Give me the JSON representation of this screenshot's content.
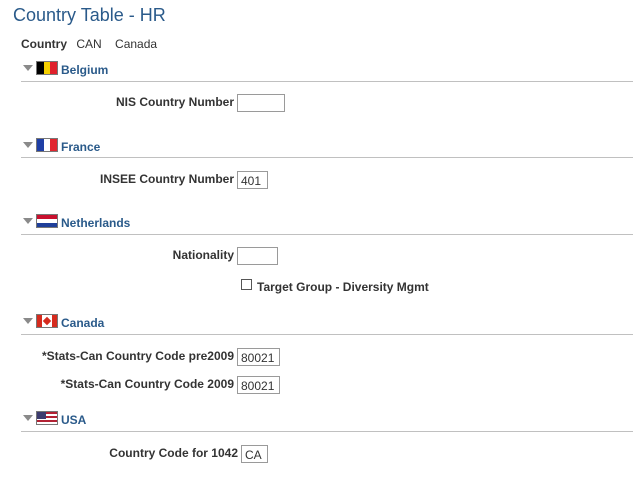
{
  "page": {
    "title": "Country Table - HR"
  },
  "country": {
    "label": "Country",
    "code": "CAN",
    "name": "Canada"
  },
  "colors": {
    "title": "#2a5a8a",
    "section_label": "#2a5a8a",
    "rule": "#c0c0c0",
    "input_border": "#9a9a9a"
  },
  "sections": {
    "belgium": {
      "label": "Belgium",
      "icon": "belgium-flag-icon",
      "fields": {
        "nis_country_number": {
          "label": "NIS Country Number",
          "value": ""
        }
      }
    },
    "france": {
      "label": "France",
      "icon": "france-flag-icon",
      "fields": {
        "insee_country_number": {
          "label": "INSEE Country Number",
          "value": "401"
        }
      }
    },
    "netherlands": {
      "label": "Netherlands",
      "icon": "netherlands-flag-icon",
      "fields": {
        "nationality": {
          "label": "Nationality",
          "value": ""
        },
        "target_group": {
          "label": "Target Group - Diversity Mgmt",
          "checked": false
        }
      }
    },
    "canada": {
      "label": "Canada",
      "icon": "canada-flag-icon",
      "fields": {
        "stats_can_pre2009": {
          "label": "*Stats-Can Country Code pre2009",
          "value": "80021"
        },
        "stats_can_2009": {
          "label": "*Stats-Can Country Code 2009",
          "value": "80021"
        }
      }
    },
    "usa": {
      "label": "USA",
      "icon": "usa-flag-icon",
      "fields": {
        "country_code_1042": {
          "label": "Country Code for 1042",
          "value": "CA"
        }
      }
    }
  }
}
